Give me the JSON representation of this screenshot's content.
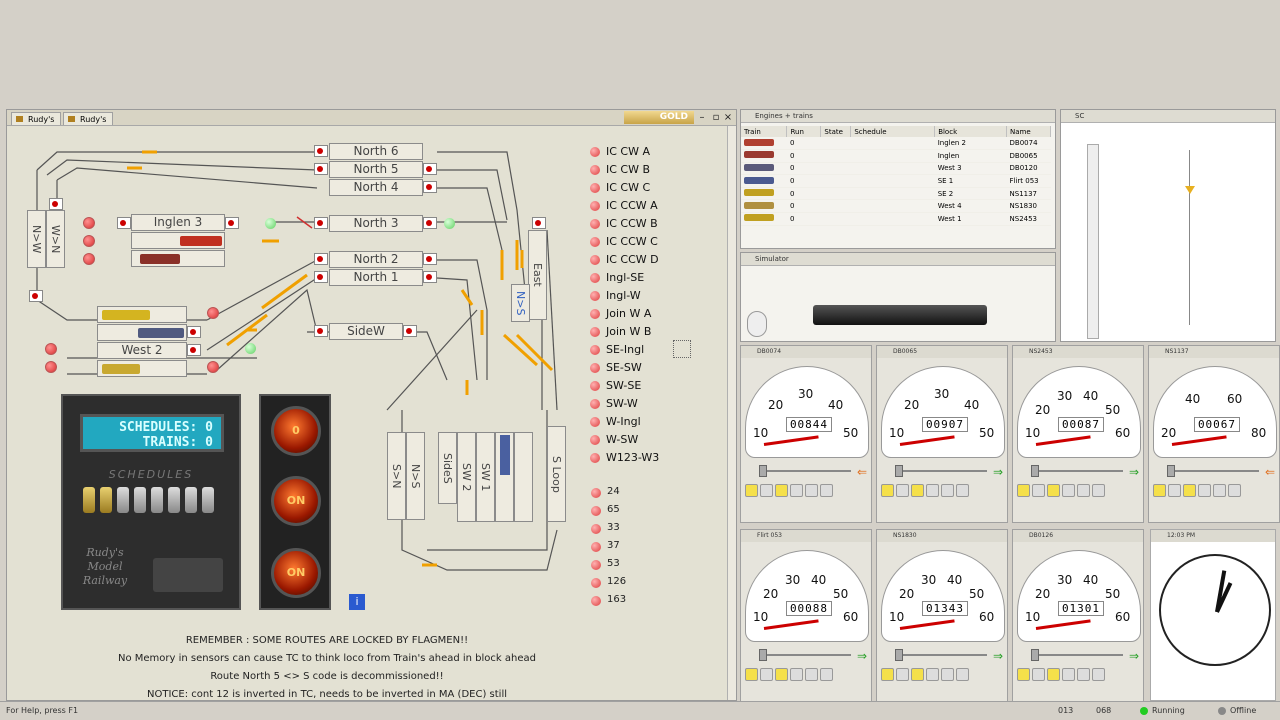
{
  "layout": {
    "tabs": [
      "Rudy's",
      "Rudy's"
    ],
    "gold_label": "GOLD",
    "blocks": {
      "north6": "North 6",
      "north5": "North 5",
      "north4": "North 4",
      "north3": "North 3",
      "north2": "North 2",
      "north1": "North 1",
      "sidew": "SideW",
      "inglen3": "Inglen 3",
      "west2": "West 2",
      "wn": "W>N",
      "nw": "N>W",
      "east": "East",
      "ns": "N>S",
      "sn_left": "S>N",
      "ns_left": "N>S",
      "sides": "SideS",
      "sw2": "SW 2",
      "sw1": "SW 1",
      "sloop": "S Loop"
    },
    "routes": [
      "IC CW A",
      "IC CW B",
      "IC CW C",
      "IC CCW A",
      "IC CCW B",
      "IC CCW C",
      "IC CCW D",
      "Ingl-SE",
      "Ingl-W",
      "Join W A",
      "Join W B",
      "SE-Ingl",
      "SE-SW",
      "SW-SE",
      "SW-W",
      "W-Ingl",
      "W-SW",
      "W123-W3"
    ],
    "numbers": [
      "24",
      "65",
      "33",
      "37",
      "53",
      "126",
      "163"
    ],
    "lcd": {
      "line1": "SCHEDULES: 0",
      "line2": "TRAINS: 0"
    },
    "schedules_title": "SCHEDULES",
    "rudy_text": "Rudy's Model Railway",
    "lamps": [
      "0",
      "ON",
      "ON"
    ],
    "notes": [
      "REMEMBER : SOME ROUTES ARE LOCKED BY FLAGMEN!!",
      "No Memory in sensors can cause TC to think loco from Train's ahead in block ahead",
      "Route North 5 <> S code is decommissioned!!",
      "NOTICE: cont 12 is inverted in TC, needs to be inverted in MA (DEC) still"
    ]
  },
  "trains": {
    "title": "Engines + trains",
    "columns": [
      "Train",
      "Run",
      "State",
      "Schedule",
      "Block",
      "Name"
    ],
    "rows": [
      {
        "run": "0",
        "block": "Inglen 2",
        "name": "DB0074",
        "color": "#b04030"
      },
      {
        "run": "0",
        "block": "Inglen",
        "name": "DB0065",
        "color": "#9a3a30"
      },
      {
        "run": "0",
        "block": "West 3",
        "name": "DB0120",
        "color": "#5a5a7a"
      },
      {
        "run": "0",
        "block": "SE 1",
        "name": "Flirt 053",
        "color": "#4a5a90"
      },
      {
        "run": "0",
        "block": "SE 2",
        "name": "NS1137",
        "color": "#c0a020"
      },
      {
        "run": "0",
        "block": "West 4",
        "name": "NS1830",
        "color": "#b09040"
      },
      {
        "run": "0",
        "block": "West 1",
        "name": "NS2453",
        "color": "#c0a020"
      }
    ]
  },
  "simulator_title": "Simulator",
  "sidepanel_title": "SC",
  "cabs": [
    {
      "title": "DB0074",
      "odo": "00844",
      "ticks": [
        "10",
        "20",
        "30",
        "40",
        "50"
      ],
      "dir": "left"
    },
    {
      "title": "DB0065",
      "odo": "00907",
      "ticks": [
        "10",
        "20",
        "30",
        "40",
        "50"
      ],
      "dir": "right"
    },
    {
      "title": "NS2453",
      "odo": "00087",
      "ticks": [
        "10",
        "20",
        "30",
        "40",
        "50",
        "60"
      ],
      "dir": "right"
    },
    {
      "title": "NS1137",
      "odo": "00067",
      "ticks": [
        "20",
        "40",
        "60",
        "80"
      ],
      "dir": "left"
    },
    {
      "title": "Flirt 053",
      "odo": "00088",
      "ticks": [
        "10",
        "20",
        "30",
        "40",
        "50",
        "60"
      ],
      "dir": "right"
    },
    {
      "title": "NS1830",
      "odo": "01343",
      "ticks": [
        "10",
        "20",
        "30",
        "40",
        "50",
        "60"
      ],
      "dir": "right"
    },
    {
      "title": "DB0126",
      "odo": "01301",
      "ticks": [
        "10",
        "20",
        "30",
        "40",
        "50",
        "60"
      ],
      "dir": "right"
    }
  ],
  "clock": {
    "title": "12:03 PM"
  },
  "status": {
    "help": "For Help, press F1",
    "running": "Running",
    "offline": "Offline",
    "a": "013",
    "b": "068"
  }
}
